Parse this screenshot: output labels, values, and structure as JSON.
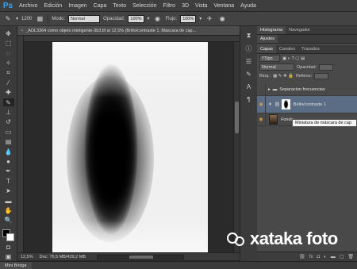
{
  "app": {
    "logo": "Ps",
    "menu": [
      "Archivo",
      "Edición",
      "Imagen",
      "Capa",
      "Texto",
      "Selección",
      "Filtro",
      "3D",
      "Vista",
      "Ventana",
      "Ayuda"
    ]
  },
  "options": {
    "brush_size": "1200",
    "mode_label": "Modo:",
    "mode_value": "Normal",
    "opacity_label": "Opacidad:",
    "opacity_value": "100%",
    "flow_label": "Flujo:",
    "flow_value": "100%"
  },
  "document": {
    "tab_title": "_ADL3364 como objeto inteligente-3b3.tif al 12,5% (Brillo/contraste 1, Máscara de cap...",
    "zoom": "12,5%",
    "doc_info": "Doc: 76,5 MB/439,2 MB"
  },
  "panels": {
    "top_tabs": [
      "Histograma",
      "Navegador"
    ],
    "adjust_tab": "Ajustes",
    "layer_tabs": [
      "Capas",
      "Canales",
      "Trazados"
    ],
    "kind_label": "Tipo",
    "blend_mode": "Normal",
    "opacity_label": "Opacidad:",
    "lock_label": "Bloq.:",
    "fill_label": "Relleno:",
    "layers": [
      {
        "name": "Separacion frecuencias"
      },
      {
        "name": "Brillo/contraste 1"
      },
      {
        "name": "Fondo"
      }
    ],
    "tooltip": "Miniatura de máscara de cap"
  },
  "status": {
    "mini_bridge": "Mini Bridge"
  },
  "watermark": "xataka foto"
}
